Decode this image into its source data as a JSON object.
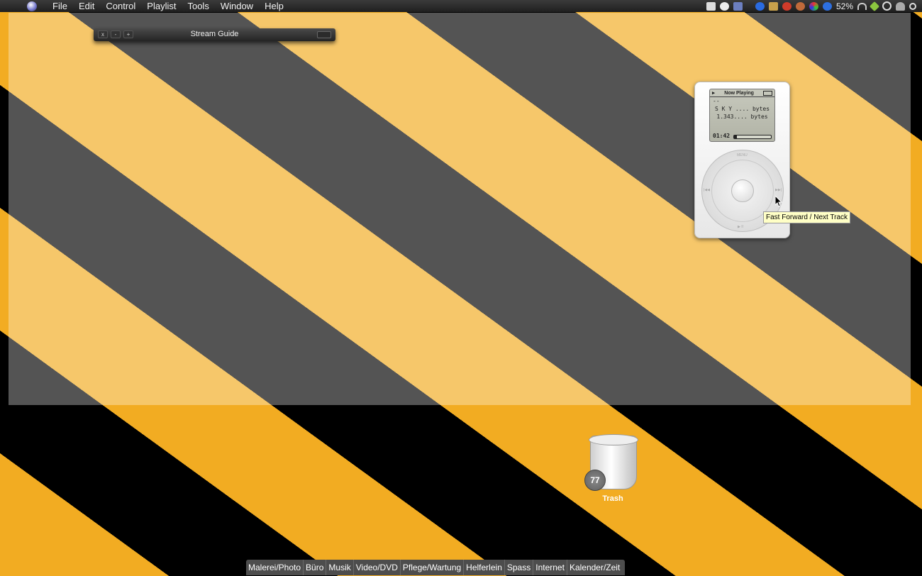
{
  "menubar": {
    "apple": "",
    "menus": [
      "File",
      "Edit",
      "Control",
      "Playlist",
      "Tools",
      "Window",
      "Help"
    ],
    "battery": "52%"
  },
  "stream_guide": {
    "title": "Stream Guide",
    "buttons": [
      "x",
      "-",
      "+"
    ]
  },
  "ipod": {
    "header": "Now Playing",
    "line1": "--",
    "line2": "S K Y .... bytes",
    "line3": "1.343.... bytes",
    "time": "01:42",
    "progress": 0.08,
    "wheel": {
      "menu": "MENU",
      "prev": "|◀◀",
      "next": "▶▶|",
      "playpause": "▶ II"
    }
  },
  "tooltip": "Fast Forward / Next Track",
  "trash": {
    "label": "Trash",
    "badge": "77"
  },
  "dock": {
    "items": [
      "Malerei/Photo",
      "Büro",
      "Musik",
      "Video/DVD",
      "Pflege/Wartung",
      "Helferlein",
      "Spass",
      "Internet",
      "Kalender/Zeit"
    ]
  },
  "colors": {
    "stripe_orange": "#f2ac22",
    "stripe_black": "#000000",
    "tooltip_bg": "#ffffc6"
  }
}
